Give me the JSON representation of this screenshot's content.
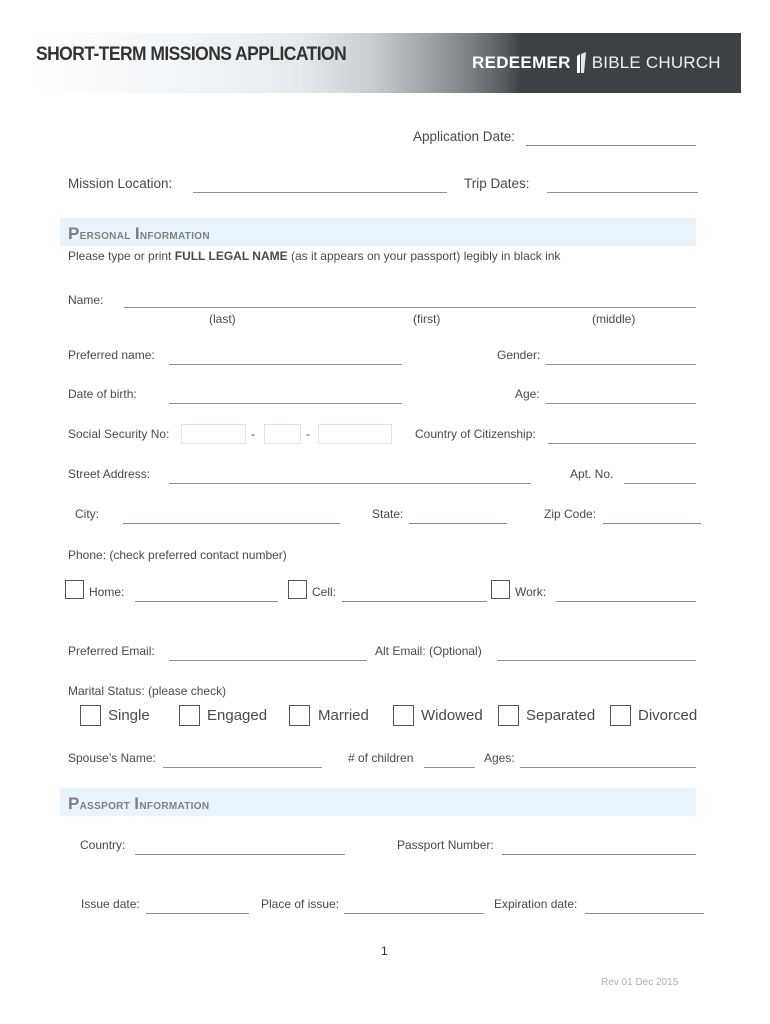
{
  "header": {
    "title": "SHORT-TERM MISSIONS APPLICATION",
    "logo_bold": "REDEEMER",
    "logo_light": "BIBLE CHURCH",
    "band_dark_color": "#3e4143"
  },
  "top_fields": {
    "application_date": {
      "label": "Application Date:",
      "value": ""
    },
    "mission_location": {
      "label": "Mission Location:",
      "value": ""
    },
    "trip_dates": {
      "label": "Trip Dates:",
      "value": ""
    }
  },
  "personal": {
    "title_cap1": "P",
    "title_rest1": "ersonal ",
    "title_cap2": "I",
    "title_rest2": "nformation",
    "instruction_pre": "Please type or print ",
    "instruction_bold": "FULL LEGAL NAME",
    "instruction_post": " (as it appears on your passport) legibly in black ink",
    "name_label": "Name:",
    "name_subs": [
      "(last)",
      "(first)",
      "(middle)"
    ],
    "preferred_name": "Preferred name:",
    "gender": "Gender:",
    "dob": "Date of birth:",
    "age": "Age:",
    "ssn": "Social Security No:",
    "ssn_sep": "-",
    "citizenship": "Country of Citizenship:",
    "street": "Street Address:",
    "apt": "Apt. No.",
    "city": "City:",
    "state": "State:",
    "zip": "Zip Code:",
    "phone_instruction": "Phone:  (check preferred contact number)",
    "phone_options": [
      {
        "label": "Home:",
        "checked": false
      },
      {
        "label": "Cell:",
        "checked": false
      },
      {
        "label": "Work:",
        "checked": false
      }
    ],
    "preferred_email": "Preferred Email:",
    "alt_email": "Alt Email: (Optional)",
    "marital_instruction": "Marital Status: (please check)",
    "marital_options": [
      {
        "label": "Single",
        "checked": false
      },
      {
        "label": "Engaged",
        "checked": false
      },
      {
        "label": "Married",
        "checked": false
      },
      {
        "label": "Widowed",
        "checked": false
      },
      {
        "label": "Separated",
        "checked": false
      },
      {
        "label": "Divorced",
        "checked": false
      }
    ],
    "spouse": "Spouse’s Name:",
    "children": "# of children",
    "ages": "Ages:"
  },
  "passport": {
    "title_cap1": "P",
    "title_rest1": "assport ",
    "title_cap2": "I",
    "title_rest2": "nformation",
    "country": "Country:",
    "number": "Passport Number:",
    "issue_date": "Issue date:",
    "place_of_issue": "Place of issue:",
    "expiration": "Expiration date:"
  },
  "footer": {
    "page_number": "1",
    "revision": "Rev 01 Dec 2015"
  },
  "colors": {
    "section_band": "#e9f3fb",
    "section_title": "#7f7f7f"
  }
}
